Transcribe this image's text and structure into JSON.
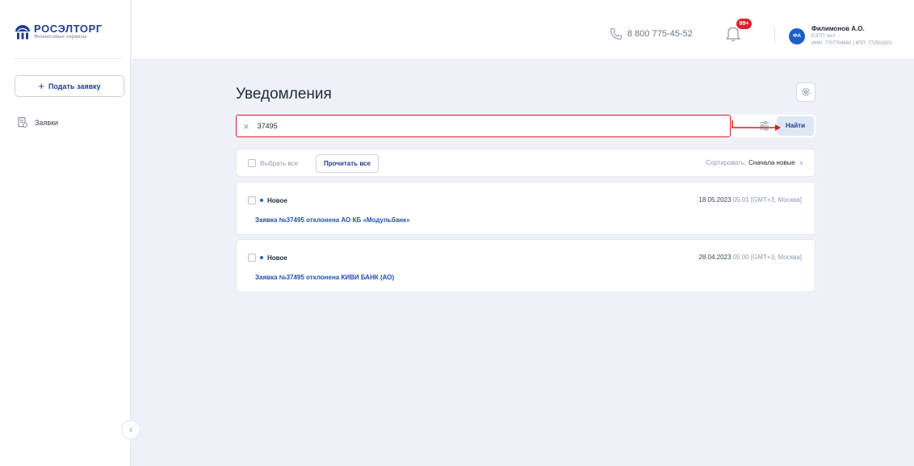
{
  "brand": {
    "name": "РОСЭЛТОРГ",
    "subtitle": "Финансовые сервисы"
  },
  "sidebar": {
    "apply_button": {
      "icon": "plus-icon",
      "label": "Подать заявку"
    },
    "items": [
      {
        "label": "Заявки",
        "icon": "document-list-icon"
      }
    ]
  },
  "header": {
    "phone": "8 800 775-45-52",
    "notifications_badge": "99+",
    "user": {
      "initials": "ФА",
      "name": "Филимонов А.О.",
      "org": "ЕЭТП тест",
      "inn": "ИНН: 7707704692 | КПП: 772501001"
    }
  },
  "page": {
    "title": "Уведомления",
    "search": {
      "value": "37495",
      "button_label": "Найти"
    },
    "toolbar": {
      "select_all_label": "Выбрать все",
      "read_all_label": "Прочитать все",
      "sort_label": "Сортировать:",
      "sort_value": "Сначала новые"
    },
    "notifications": [
      {
        "status": "Новое",
        "date": "18.05.2023",
        "time": "05:01 [GMT+3, Москва]",
        "text": "Заявка №37495 отклонена АО КБ «Модульбанк»"
      },
      {
        "status": "Новое",
        "date": "28.04.2023",
        "time": "05:00 [GMT+3, Москва]",
        "text": "Заявка №37495 отклонена КИВИ БАНК (АО)"
      }
    ]
  },
  "colors": {
    "accent": "#1f3f8f",
    "highlight": "#d81c28",
    "badge": "#e0202e"
  }
}
